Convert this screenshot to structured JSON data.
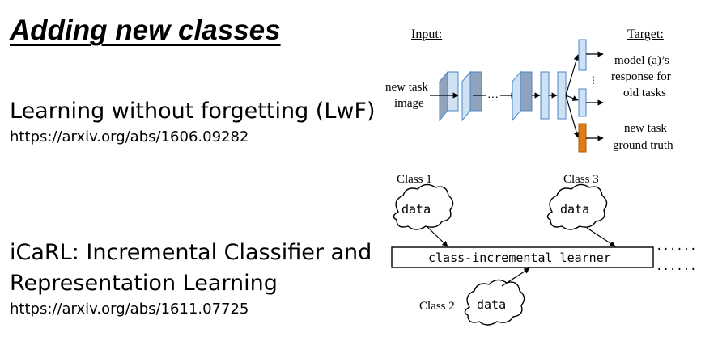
{
  "slide": {
    "title": "Adding new classes",
    "lwf": {
      "heading": "Learning without forgetting (LwF)",
      "link": "https://arxiv.org/abs/1606.09282"
    },
    "icarl": {
      "heading_line1": "iCaRL: Incremental Classifier and",
      "heading_line2": "Representation Learning",
      "link": "https://arxiv.org/abs/1611.07725"
    }
  },
  "lwf_figure": {
    "input_label": "Input:",
    "target_label": "Target:",
    "image_label_line1": "new task",
    "image_label_line2": "image",
    "old_target_line1": "model (a)’s",
    "old_target_line2": "response for",
    "old_target_line3": "old tasks",
    "new_target_line1": "new task",
    "new_target_line2": "ground truth",
    "colors": {
      "layer_fill": "#cfe2f3",
      "layer_stroke": "#4a86c8",
      "conv_side": "#8fa3bf",
      "new_head": "#e07b1a"
    }
  },
  "icarl_figure": {
    "class1_label": "Class 1",
    "class2_label": "Class 2",
    "class3_label": "Class 3",
    "cloud_text": "data",
    "learner_label": "class-incremental learner",
    "ellipsis": "......"
  }
}
